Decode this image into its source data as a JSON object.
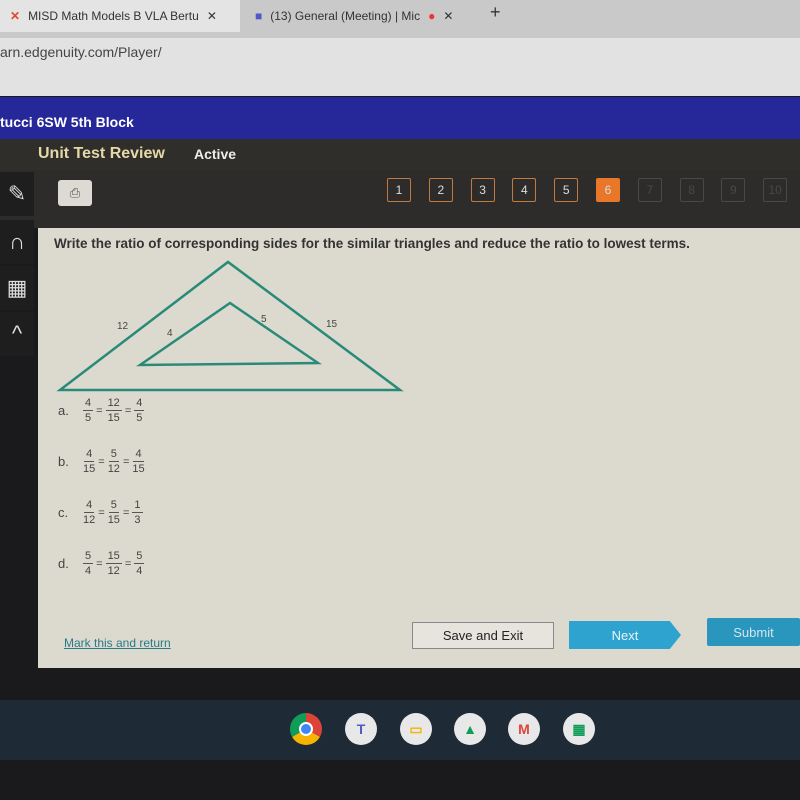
{
  "browser": {
    "tabs": [
      {
        "title": "MISD Math Models B VLA Bertu"
      },
      {
        "title": "(13) General (Meeting) | Mic"
      }
    ],
    "url": "arn.edgenuity.com/Player/"
  },
  "course": {
    "title": "tucci 6SW 5th Block"
  },
  "activity": {
    "title": "Unit Test Review",
    "status": "Active"
  },
  "questions": {
    "numbers": [
      "1",
      "2",
      "3",
      "4",
      "5",
      "6",
      "7",
      "8",
      "9",
      "10"
    ],
    "current": 6,
    "answered": 5
  },
  "question": {
    "prompt": "Write the ratio of corresponding sides for the similar triangles and reduce the ratio to lowest terms.",
    "figure_labels": {
      "outer_left": "12",
      "inner_left": "4",
      "inner_right": "5",
      "outer_right": "15"
    },
    "options": [
      {
        "letter": "a.",
        "fracs": [
          [
            "4",
            "5"
          ],
          [
            "12",
            "15"
          ],
          [
            "4",
            "5"
          ]
        ]
      },
      {
        "letter": "b.",
        "fracs": [
          [
            "4",
            "15"
          ],
          [
            "5",
            "12"
          ],
          [
            "4",
            "15"
          ]
        ]
      },
      {
        "letter": "c.",
        "fracs": [
          [
            "4",
            "12"
          ],
          [
            "5",
            "15"
          ],
          [
            "1",
            "3"
          ]
        ]
      },
      {
        "letter": "d.",
        "fracs": [
          [
            "5",
            "4"
          ],
          [
            "15",
            "12"
          ],
          [
            "5",
            "4"
          ]
        ]
      }
    ]
  },
  "footer": {
    "mark": "Mark this and return",
    "save": "Save and Exit",
    "next": "Next",
    "submit": "Submit"
  },
  "colors": {
    "accent": "#e8772a",
    "next": "#2ea3cf",
    "submit": "#2b96bd",
    "triangle": "#2a8a7a",
    "header": "#26289a"
  },
  "shelf": [
    "chrome",
    "teams",
    "slides",
    "drive",
    "gmail",
    "sheets"
  ]
}
